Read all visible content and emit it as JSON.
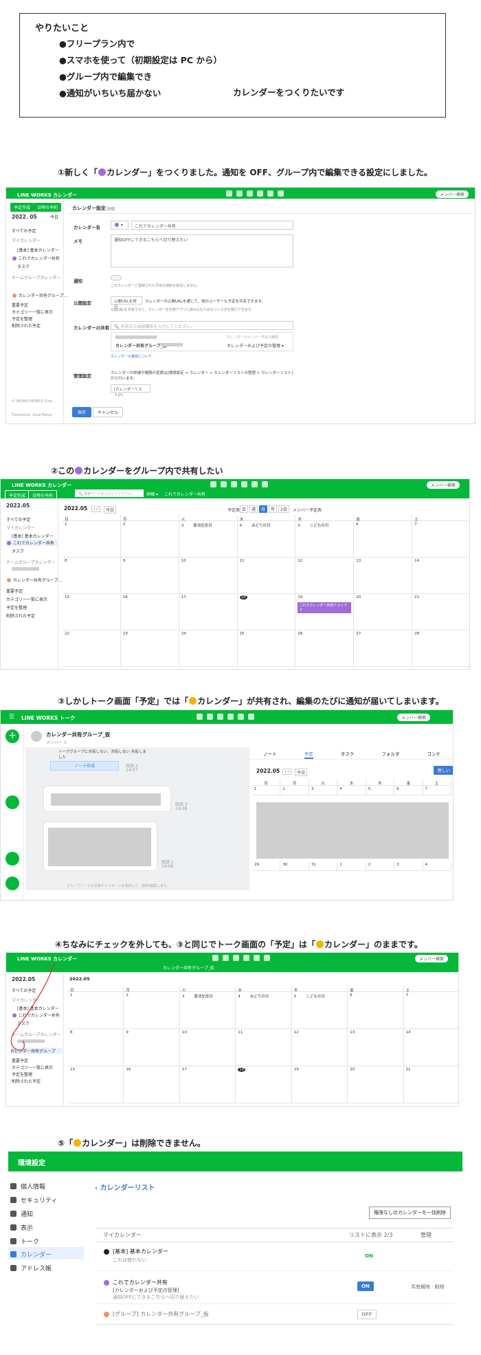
{
  "note": {
    "title": "やりたいこと",
    "items": [
      "●フリープラン内で",
      "●スマホを使って（初期設定は PC から）",
      "●グループ内で編集でき",
      "●通知がいちいち届かない"
    ],
    "goal": "カレンダーをつくりたいです"
  },
  "captions": {
    "c1": "①新しく「●カレンダー」をつくりました。通知を OFF、グループ内で編集できる設定にしました。",
    "c2": "②この●カレンダーをグループ内で共有したい",
    "c3": "③しかしトーク画面「予定」では「●カレンダー」が共有され、編集のたびに通知が届いてしまいます。",
    "c4": "④ちなみにチェックを外しても、③と同じでトーク画面の「予定」は「●カレンダー」のままです。",
    "c5": "⑤「●カレンダー」は削除できません。"
  },
  "colors": {
    "green": "#06b83a",
    "purple": "#a06ad8",
    "yellow": "#f5b400",
    "orange": "#f09070"
  },
  "shot1": {
    "brand": "LINE WORKS カレンダー",
    "member": "メンバー検索",
    "btn_new": "予定作成",
    "btn_invite": "日時の予約",
    "date": "2022. 05",
    "today": "今日",
    "sidebar": [
      "すべての予定",
      "マイカレンダー",
      "[基本] 基本カレンダー",
      "これでカレンダー共有",
      "タスク",
      "チームグループカレンダー",
      "カレンダー共有グループ...",
      "重要予定",
      "カテゴリー一覧に表示",
      "予定を整理",
      "削除された予定"
    ],
    "footer": "© WORKS MOBILE Corp.",
    "timezone": "Timezone: Asia/Tokyo",
    "page_title": "カレンダー設定",
    "page_sub": "詳細",
    "lbl_name": "カレンダー名",
    "val_name": "これでカレンダー共有",
    "lbl_memo": "メモ",
    "val_memo": "通知OFFにできるこちらへ切り替えたい",
    "lbl_notify": "通知",
    "notify_hint": "このカレンダーに登録された予定の通知を受信しません。",
    "lbl_public": "公開設定",
    "btn_public": "公開URLを発行",
    "public_text": "カレンダーの公開URLを通じて、他のユーザーも予定を共有できます。",
    "public_hint": "公開URLを共有すると、カレンダーを外部アプリに読み込むためのリンクがを発行できます。",
    "lbl_share": "カレンダーの共有",
    "share_placeholder": "名前または組織名を入力してください。",
    "share_right_hint": "カレンダーのメンバー予定の権限",
    "share_group": "カレンダー共有グループ_仮",
    "share_perm": "カレンダーおよび予定の管理 ▾",
    "share_link": "カレンダーの権限について",
    "lbl_admin": "管理設定",
    "admin_text": "カレンダーの詳細や権限の変更は[環境設定 > カレンダー > カレンダーリストの管理 > カレンダーリスト]から行います。",
    "admin_btn": "[カレンダーリスト]へ",
    "btn_save": "保存",
    "btn_cancel": "キャンセル"
  },
  "shot2": {
    "brand": "LINE WORKS カレンダー",
    "member": "メンバー検索",
    "search_placeholder": "検索ワードを入力してください。",
    "search_btn": "詳細 ▾",
    "tab_label": "これでカレンダー共有",
    "date": "2022.05",
    "today": "今日",
    "view_label": "予定表",
    "views": [
      "日",
      "週",
      "月",
      "年",
      "2日"
    ],
    "member_label": "メンバー予定表",
    "weekdays": [
      "日",
      "月",
      "火",
      "水",
      "木",
      "金",
      "土"
    ],
    "weeks": [
      [
        "1",
        "2",
        "3",
        "4",
        "5",
        "6",
        "7"
      ],
      [
        "8",
        "9",
        "10",
        "11",
        "12",
        "13",
        "14"
      ],
      [
        "15",
        "16",
        "17",
        "18",
        "19",
        "20",
        "21"
      ],
      [
        "22",
        "23",
        "24",
        "25",
        "26",
        "27",
        "28"
      ]
    ],
    "holidays": {
      "3": "憲法記念日",
      "4": "みどりの日",
      "5": "こどもの日"
    },
    "event_label": "これでカレンダー共有テストです"
  },
  "shot3": {
    "brand": "LINE WORKS トーク",
    "member": "メンバー検索",
    "room_title": "カレンダー共有グループ_仮",
    "room_sub": "メンバー 3",
    "sys_msg": "トークグループに共有しない、共有しない 共有しました",
    "note_btn": "ノート作成",
    "read_label": "既読 2",
    "time1": "14:07",
    "time2": "14:08",
    "tabs": [
      "ノート",
      "予定",
      "タスク",
      "フォルダ",
      "コンテ"
    ],
    "date": "2022.05",
    "today": "今日",
    "new_btn": "新しい",
    "weekdays": [
      "日",
      "月",
      "火",
      "水",
      "木",
      "金",
      "土"
    ],
    "first_row": [
      "1",
      "2",
      "3",
      "4",
      "5",
      "6",
      "7"
    ],
    "last_row": [
      "29",
      "30",
      "31",
      "1",
      "2",
      "3",
      "4"
    ],
    "footer_msg": "グループトークの写真やメッセージを保存して、削除/編集します。"
  },
  "shot4": {
    "brand": "LINE WORKS カレンダー",
    "member": "メンバー検索",
    "tab_label": "カレンダー共有グループ_仮",
    "date": "2022.05",
    "sidebar": [
      "すべての予定",
      "マイカレンダー",
      "[基本] 基本カレンダー",
      "これでカレンダー共有",
      "タスク",
      "チームグループカレンダー",
      "カレンダー共有グループ",
      "重要予定",
      "カテゴリー一覧に表示",
      "予定を整理",
      "削除された予定"
    ],
    "weeks": [
      [
        "1",
        "2",
        "3",
        "4",
        "5",
        "6",
        "7"
      ],
      [
        "8",
        "9",
        "10",
        "11",
        "12",
        "13",
        "14"
      ],
      [
        "15",
        "16",
        "17",
        "18",
        "19",
        "20",
        "21"
      ]
    ],
    "holidays": {
      "3": "憲法記念日",
      "4": "みどりの日",
      "5": "こどもの日"
    }
  },
  "shot5": {
    "header": "環境設定",
    "menu": [
      "個人情報",
      "セキュリティ",
      "通知",
      "表示",
      "トーク",
      "カレンダー",
      "アドレス帳"
    ],
    "back_title": "カレンダーリスト",
    "bulk_btn": "権限なしのカレンダーを一括削除",
    "col_my": "マイカレンダー",
    "col_show": "リストに表示 2/3",
    "col_manage": "管理",
    "rows": [
      {
        "name": "[基本] 基本カレンダー",
        "sub": "これは使わない",
        "state": "ON",
        "manage": ""
      },
      {
        "name": "これでカレンダー共有",
        "sub": "[カレンダーおよび予定の管理]",
        "sub2": "通知OFFにできるこちらへ切り替えたい",
        "state": "ON",
        "manage": "共有解除 · 削除"
      },
      {
        "name": "[グループ] カレンダー共有グループ_仮",
        "sub": "",
        "state": "OFF",
        "manage": ""
      }
    ]
  }
}
